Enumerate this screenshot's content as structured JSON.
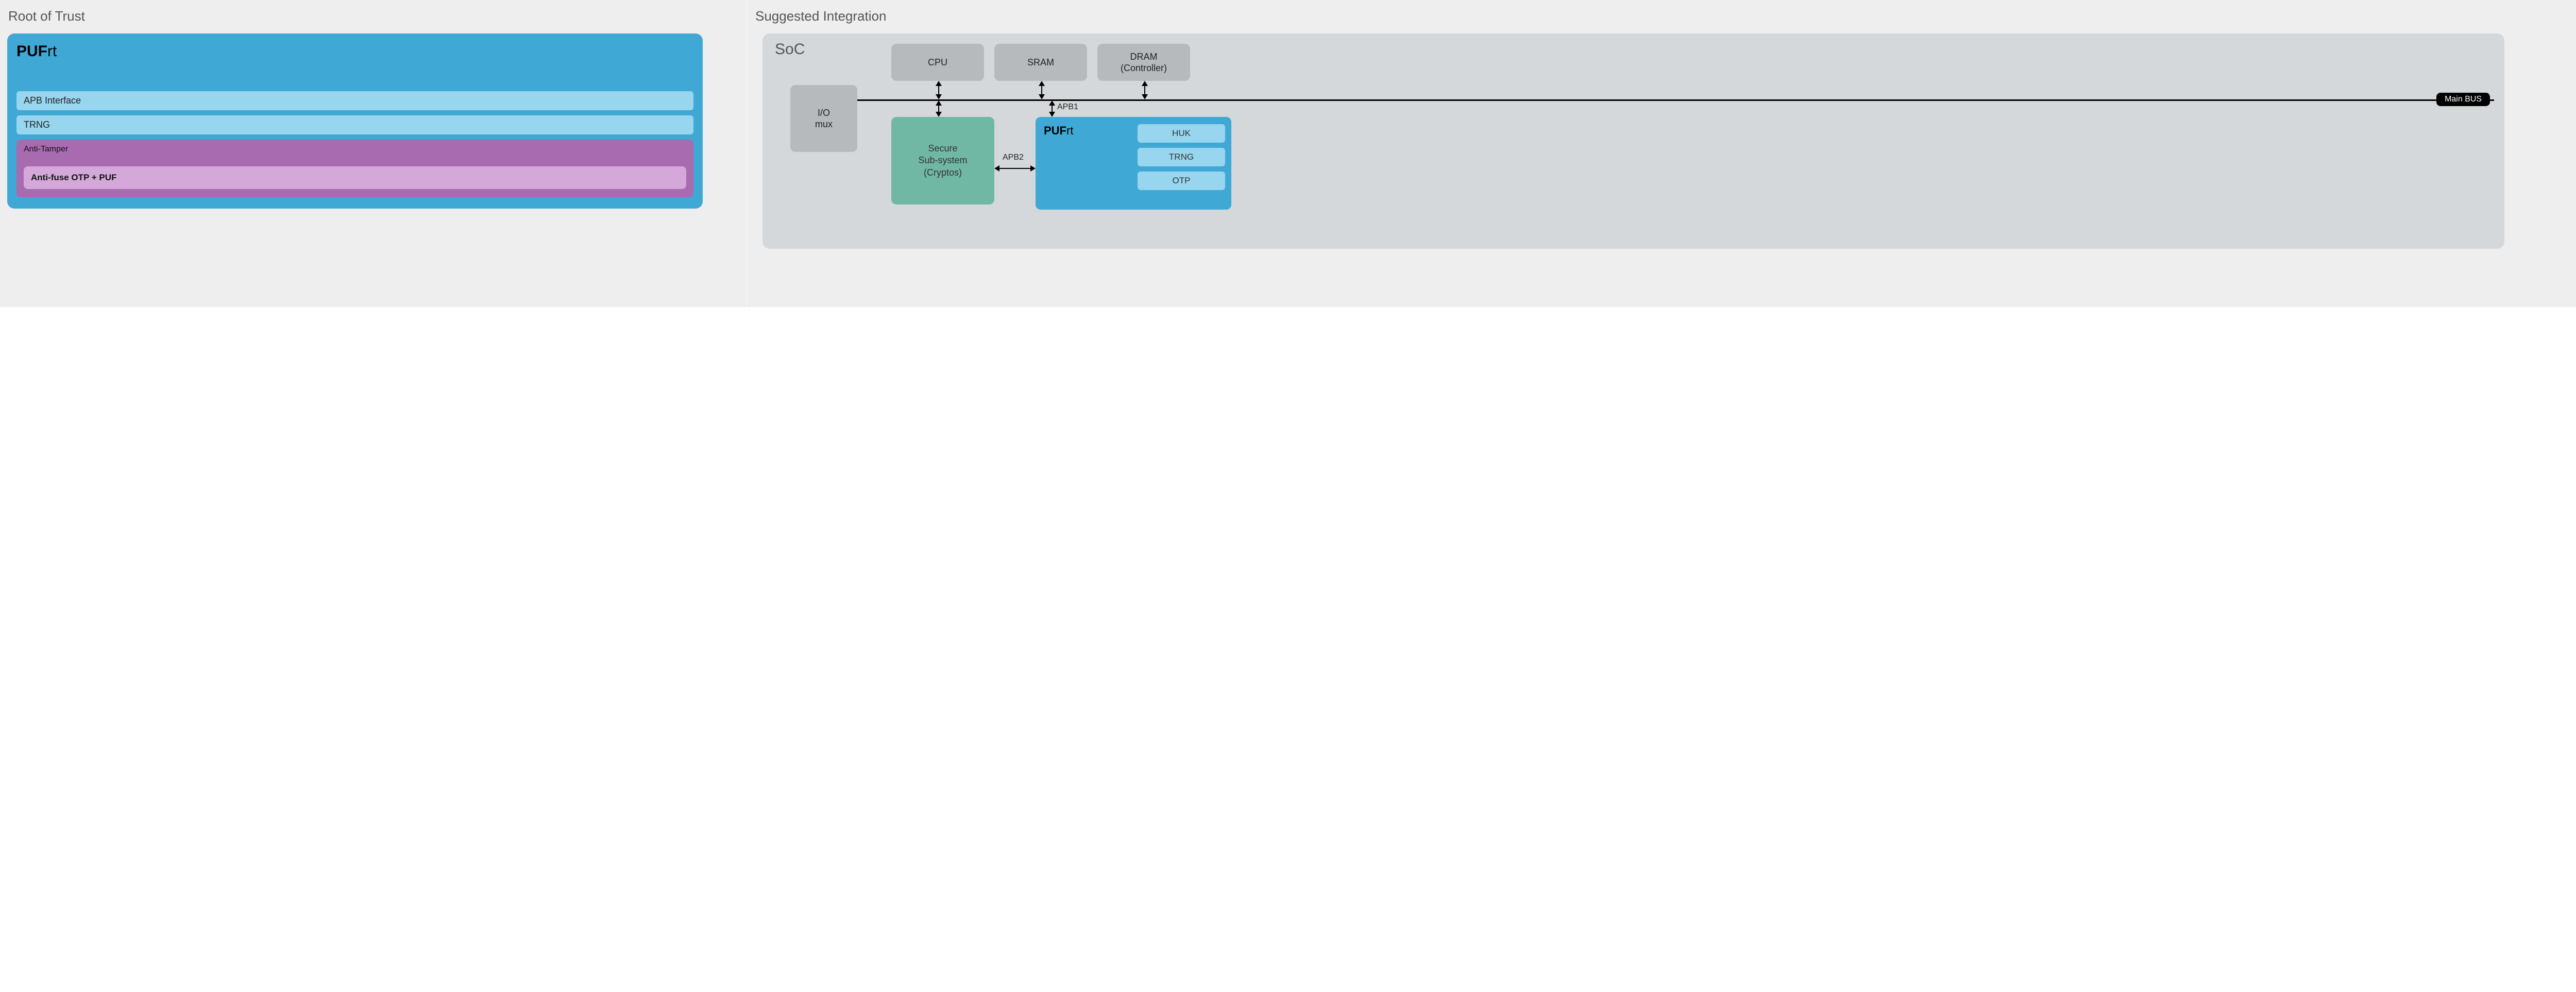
{
  "left": {
    "title": "Root of Trust",
    "card": {
      "name_bold": "PUF",
      "name_rest": "rt",
      "apb": "APB Interface",
      "trng": "TRNG",
      "tamper_label": "Anti-Tamper",
      "tamper_inner": "Anti-fuse OTP + PUF"
    }
  },
  "right": {
    "title": "Suggested Integration",
    "soc_label": "SoC",
    "io": "I/O\nmux",
    "cpu": "CPU",
    "sram": "SRAM",
    "dram": "DRAM\n(Controller)",
    "mainbus": "Main BUS",
    "secure": "Secure\nSub-system\n(Cryptos)",
    "apb1": "APB1",
    "apb2": "APB2",
    "pufrt": {
      "name_bold": "PUF",
      "name_rest": "rt",
      "huk": "HUK",
      "trng": "TRNG",
      "otp": "OTP"
    }
  }
}
